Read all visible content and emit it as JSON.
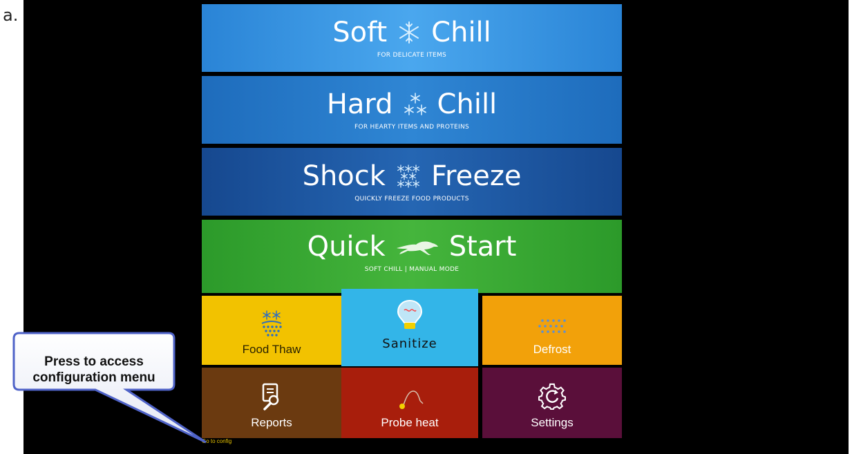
{
  "figure_label": "a.",
  "modes": {
    "soft": {
      "title_left": "Soft",
      "title_right": "Chill",
      "subtitle": "FOR DELICATE ITEMS"
    },
    "hard": {
      "title_left": "Hard",
      "title_right": "Chill",
      "subtitle": "FOR HEARTY ITEMS AND PROTEINS"
    },
    "shock": {
      "title_left": "Shock",
      "title_right": "Freeze",
      "subtitle": "QUICKLY FREEZE FOOD PRODUCTS"
    },
    "quick": {
      "title_left": "Quick",
      "title_right": "Start",
      "subtitle": "SOFT CHILL | MANUAL MODE"
    }
  },
  "tiles": {
    "food_thaw": "Food Thaw",
    "sanitize": "Sanitize",
    "defrost": "Defrost",
    "reports": "Reports",
    "probe_heat": "Probe heat",
    "settings": "Settings"
  },
  "config_link": "Go to config",
  "callout": {
    "line1": "Press to access",
    "line2": "configuration menu"
  },
  "colors": {
    "soft": "#3a96e4",
    "hard": "#2778c8",
    "shock": "#1d56a0",
    "quick": "#3aa835",
    "food_thaw": "#f2c200",
    "sanitize": "#33b5e8",
    "defrost": "#f2a10a",
    "reports": "#6b3a10",
    "probe_heat": "#a81e0c",
    "settings": "#5a0f3a"
  },
  "icons": {
    "soft": "single-snowflake-icon",
    "hard": "triple-snowflake-icon",
    "shock": "many-snowflakes-icon",
    "quick": "running-greyhound-icon",
    "food_thaw": "melting-snowflakes-icon",
    "sanitize": "uv-bulb-icon",
    "defrost": "droplets-icon",
    "reports": "report-magnifier-icon",
    "probe_heat": "probe-heat-icon",
    "settings": "gear-icon"
  }
}
